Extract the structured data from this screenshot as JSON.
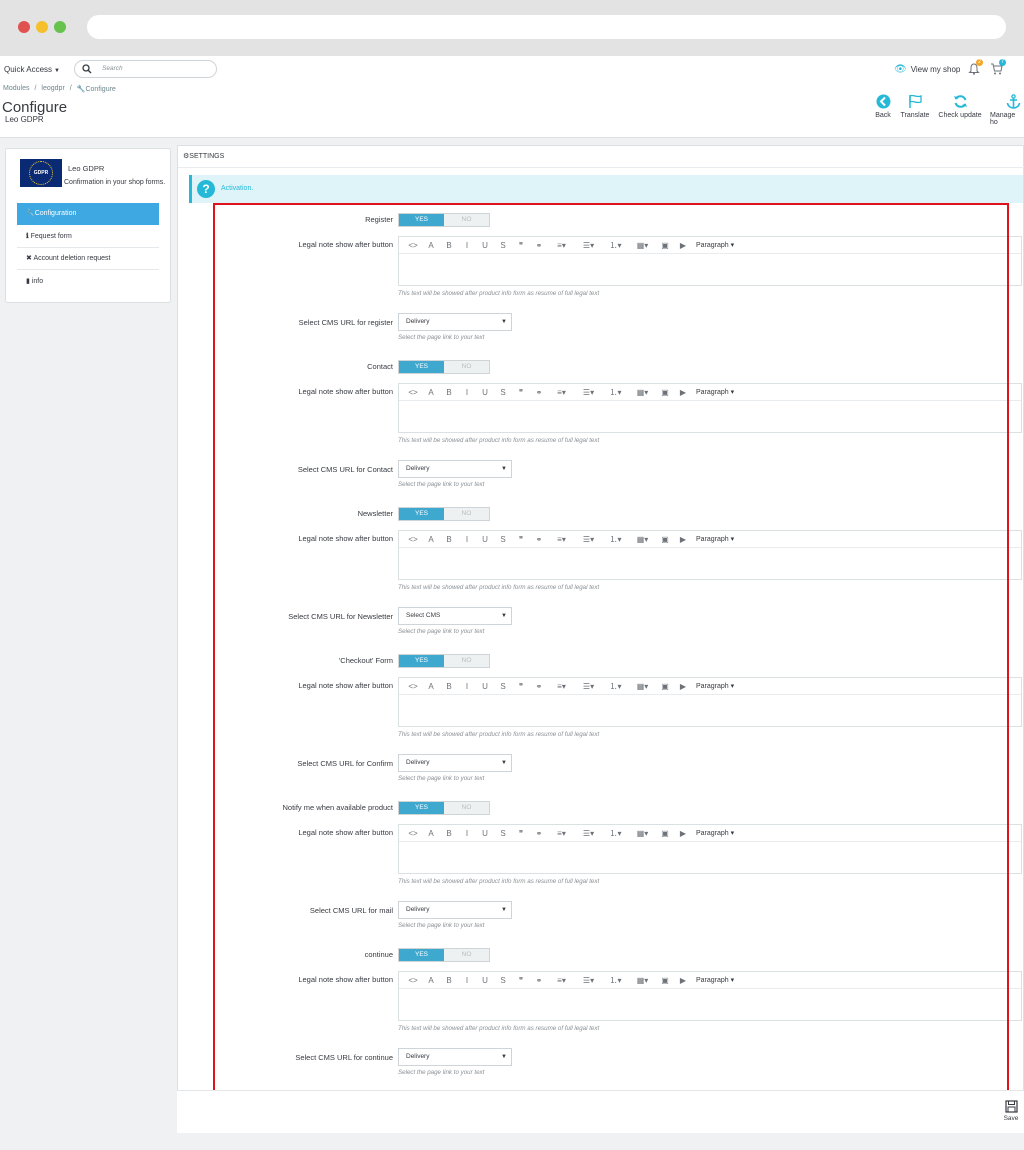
{
  "topnav": {
    "quick_access": "Quick Access",
    "search_placeholder": "Search",
    "view_shop": "View my shop",
    "bell_badge": "2",
    "cart_badge": "7"
  },
  "header": {
    "breadcrumb": [
      "Modules",
      "/",
      "leogdpr",
      "/",
      "Configure"
    ],
    "title": "Configure",
    "subtitle": "Leo GDPR",
    "toolbar": [
      {
        "label": "Back",
        "icon": "back-icon"
      },
      {
        "label": "Translate",
        "icon": "flag-icon"
      },
      {
        "label": "Check update",
        "icon": "refresh-icon"
      },
      {
        "label": "Manage ho",
        "icon": "anchor-icon"
      }
    ]
  },
  "sidebar": {
    "logo_text": "GDPR",
    "module_name": "Leo GDPR",
    "module_desc": "Confirmation in your shop forms.",
    "items": [
      {
        "label": "Configuration",
        "icon": "wrench-icon",
        "active": true
      },
      {
        "label": "Fequest form",
        "icon": "info-icon",
        "active": false
      },
      {
        "label": "Account deletion request",
        "icon": "close-icon",
        "active": false
      },
      {
        "label": "info",
        "icon": "file-icon",
        "active": false
      }
    ]
  },
  "main": {
    "settings_title": "SETTINGS",
    "alert_text": "Activation.",
    "toggle_yes": "YES",
    "toggle_no": "NO",
    "editor_paragraph": "Paragraph",
    "legal_help": "This text will be showed after product info form as resume of full legal text",
    "select_help": "Select the page link to your text",
    "sections": [
      {
        "toggle_label": "Register",
        "legal_label": "Legal note show after button",
        "select_label": "Select CMS URL for register",
        "select_value": "Delivery"
      },
      {
        "toggle_label": "Contact",
        "legal_label": "Legal note show after button",
        "select_label": "Select CMS URL for Contact",
        "select_value": "Delivery"
      },
      {
        "toggle_label": "Newsletter",
        "legal_label": "Legal note show after button",
        "select_label": "Select CMS URL for Newsletter",
        "select_value": "Select CMS"
      },
      {
        "toggle_label": "'Checkout' Form",
        "legal_label": "Legal note show after button",
        "select_label": "Select CMS URL for Confirm",
        "select_value": "Delivery"
      },
      {
        "toggle_label": "Notify me when available product",
        "legal_label": "Legal note show after button",
        "select_label": "Select CMS URL for mail",
        "select_value": "Delivery"
      },
      {
        "toggle_label": "continue",
        "legal_label": "Legal note show after button",
        "select_label": "Select CMS URL for continue",
        "select_value": "Delivery"
      }
    ],
    "save_label": "Save"
  },
  "colors": {
    "accent": "#25b9d7",
    "active_nav": "#3ea8e2",
    "toggle_on": "#3ea8cf",
    "highlight_frame": "#e0131c"
  }
}
